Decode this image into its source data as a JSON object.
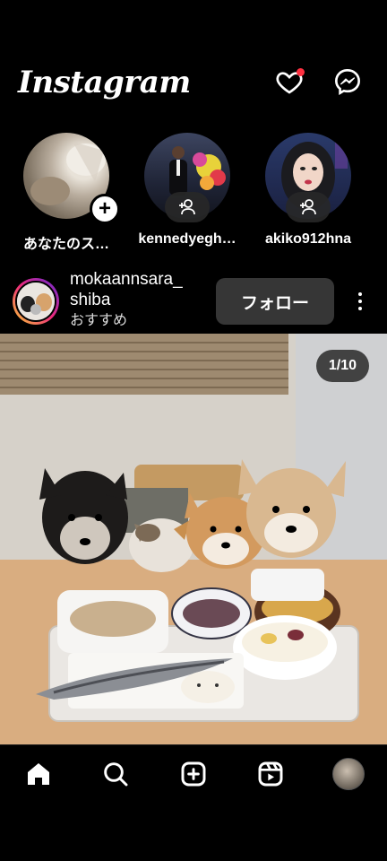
{
  "header": {
    "logo": "Instagram",
    "icons": [
      "heart-icon",
      "messenger-icon"
    ],
    "notification_dot_color": "#ff3040"
  },
  "stories": [
    {
      "label": "あなたのス…",
      "badge": "+"
    },
    {
      "label": "kennedyegh…",
      "badge": "follow-icon"
    },
    {
      "label": "akiko912hna",
      "badge": "follow-icon"
    }
  ],
  "post": {
    "username": "mokaannsara_ shiba",
    "subtitle": "おすすめ",
    "follow_label": "フォロー",
    "photo_counter": "1/10"
  },
  "bottom_nav": [
    "home-icon",
    "search-icon",
    "create-icon",
    "reels-icon",
    "profile-avatar"
  ]
}
